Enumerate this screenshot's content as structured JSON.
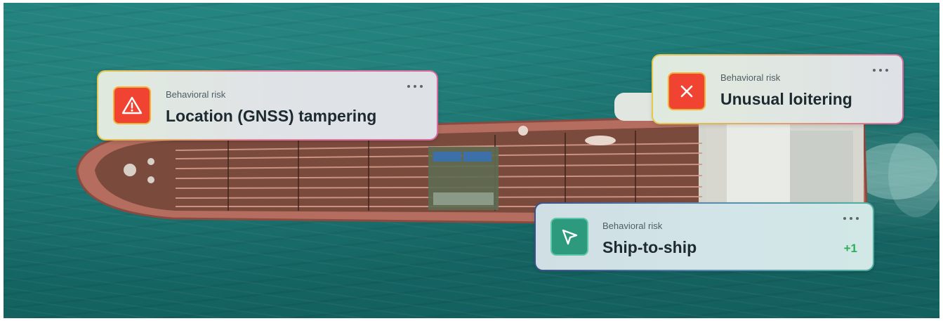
{
  "cards": [
    {
      "kicker": "Behavioral risk",
      "title": "Location (GNSS) tampering",
      "icon": "warning-triangle-icon",
      "accent": "#f04332"
    },
    {
      "kicker": "Behavioral risk",
      "title": "Unusual loitering",
      "icon": "close-x-icon",
      "accent": "#f04332"
    },
    {
      "kicker": "Behavioral risk",
      "title": "Ship-to-ship",
      "icon": "navigation-arrow-icon",
      "accent": "#2e9a7d",
      "badge": "+1"
    }
  ],
  "colors": {
    "sea": "#1a7572",
    "hull": "#c47d6c",
    "deck": "#7a4a3d",
    "badge_green": "#2fae5b"
  }
}
